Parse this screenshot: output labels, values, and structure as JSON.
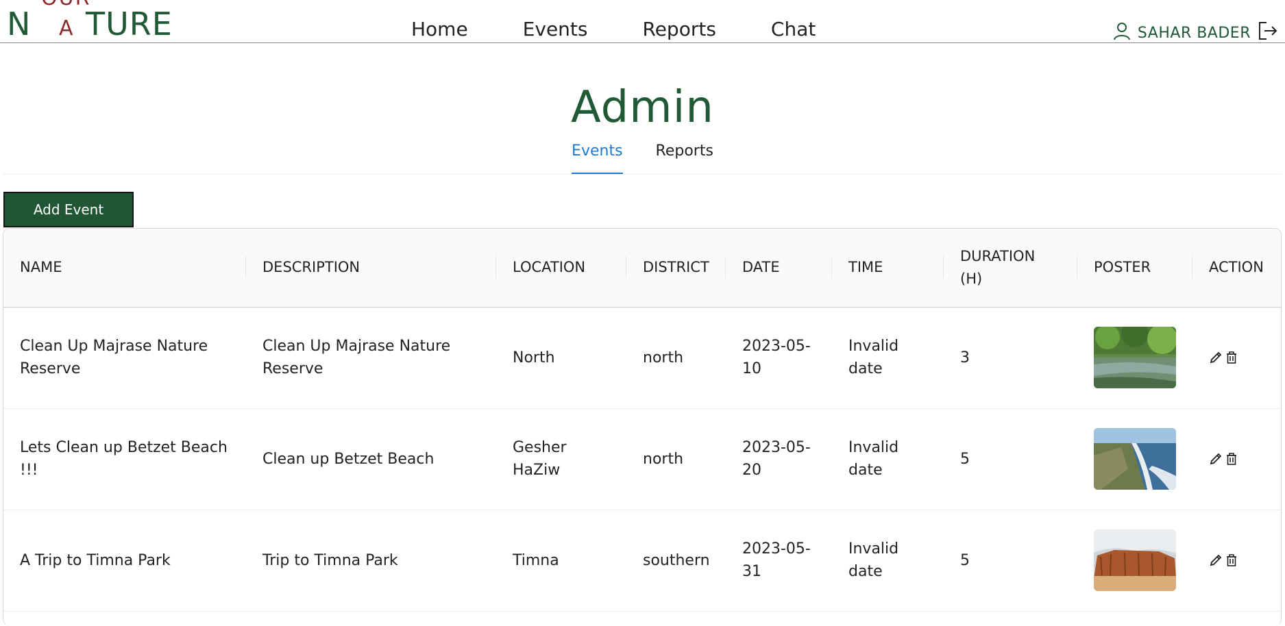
{
  "header": {
    "logo": {
      "n": "N",
      "ture": "TURE",
      "our": "OUR",
      "a": "A"
    },
    "nav": [
      "Home",
      "Events",
      "Reports",
      "Chat"
    ],
    "user_name": "SAHAR BADER"
  },
  "page_title": "Admin",
  "tabs": [
    "Events",
    "Reports"
  ],
  "active_tab": "Events",
  "add_event_label": "Add Event",
  "table": {
    "columns": [
      "NAME",
      "DESCRIPTION",
      "LOCATION",
      "DISTRICT",
      "DATE",
      "TIME",
      "DURATION (H)",
      "POSTER",
      "ACTION"
    ],
    "rows": [
      {
        "name": "Clean Up Majrase Nature Reserve",
        "description": "Clean Up Majrase Nature Reserve",
        "location": "North",
        "district": "north",
        "date": "2023-05-10",
        "time": "Invalid date",
        "duration": "3",
        "poster": "river-reserve"
      },
      {
        "name": "Lets Clean up Betzet Beach !!!",
        "description": "Clean up Betzet Beach",
        "location": "Gesher HaZiw",
        "district": "north",
        "date": "2023-05-20",
        "time": "Invalid date",
        "duration": "5",
        "poster": "coast-beach"
      },
      {
        "name": "A Trip to Timna Park",
        "description": "Trip to Timna Park",
        "location": "Timna",
        "district": "southern",
        "date": "2023-05-31",
        "time": "Invalid date",
        "duration": "5",
        "poster": "desert-cliffs"
      }
    ]
  },
  "colors": {
    "brand_green": "#1f5a34",
    "button_green": "#215634",
    "accent_blue": "#1f78d1",
    "logo_red": "#8b2b2b"
  }
}
